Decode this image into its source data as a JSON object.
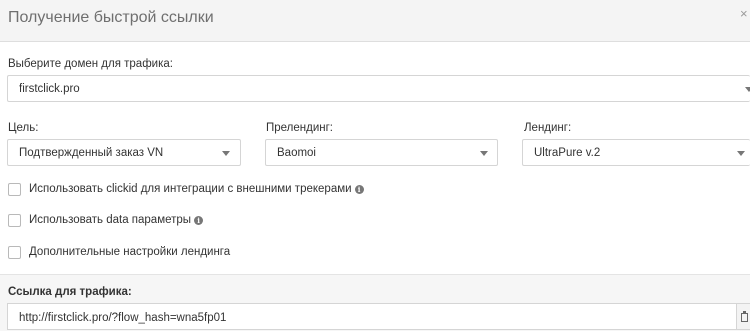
{
  "header": {
    "title": "Получение быстрой ссылки",
    "close_icon": "close-icon"
  },
  "domain": {
    "label": "Выберите домен для трафика:",
    "value": "firstclick.pro"
  },
  "goal": {
    "label": "Цель:",
    "value": "Подтвержденный заказ VN"
  },
  "prelanding": {
    "label": "Прелендинг:",
    "value": "Baomoi"
  },
  "landing": {
    "label": "Лендинг:",
    "value": "UltraPure v.2"
  },
  "options": [
    {
      "label": "Использовать clickid для интеграции с внешними трекерами",
      "checked": false,
      "has_info": true
    },
    {
      "label": "Использовать data параметры",
      "checked": false,
      "has_info": true
    },
    {
      "label": "Дополнительные настройки лендинга",
      "checked": false,
      "has_info": false
    }
  ],
  "traffic_link": {
    "label": "Ссылка для трафика:",
    "value": "http://firstclick.pro/?flow_hash=wna5fp01",
    "copy_icon": "clipboard-icon"
  }
}
